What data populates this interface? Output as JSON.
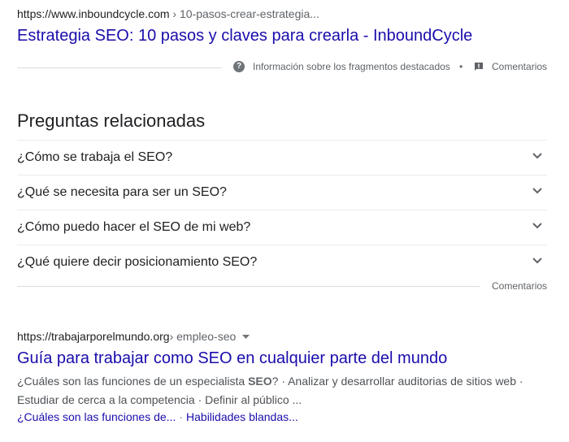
{
  "result1": {
    "cite_domain": "https://www.inboundcycle.com",
    "cite_path": " › 10-pasos-crear-estrategia...",
    "title": "Estrategia SEO: 10 pasos y claves para crearla - InboundCycle"
  },
  "featured_snippet_footer": {
    "about_label": "Información sobre los fragmentos destacados",
    "separator": "•",
    "feedback_label": "Comentarios",
    "about_icon": "help-circle-icon",
    "feedback_icon": "feedback-icon"
  },
  "people_also_ask": {
    "heading": "Preguntas relacionadas",
    "questions": [
      "¿Cómo se trabaja el SEO?",
      "¿Qué se necesita para ser un SEO?",
      "¿Cómo puedo hacer el SEO de mi web?",
      "¿Qué quiere decir posicionamiento SEO?"
    ],
    "feedback_label": "Comentarios"
  },
  "result2": {
    "cite_domain": "https://trabajarporelmundo.org",
    "cite_path": " › empleo-seo",
    "title": "Guía para trabajar como SEO en cualquier parte del mundo",
    "snippet_before_bold": "¿Cuáles son las funciones de un especialista ",
    "snippet_bold": "SEO",
    "snippet_after_bold": "? · Analizar y desarrollar auditorias de sitios web · Estudiar de cerca a la competencia · Definir al público ...",
    "sitelinks": [
      "¿Cuáles son las funciones de...",
      "Habilidades blandas..."
    ],
    "sitelink_separator": "·"
  },
  "colors": {
    "link": "#1a0dab",
    "text": "#202124",
    "secondary": "#5f6368",
    "divider": "#dadce0"
  }
}
